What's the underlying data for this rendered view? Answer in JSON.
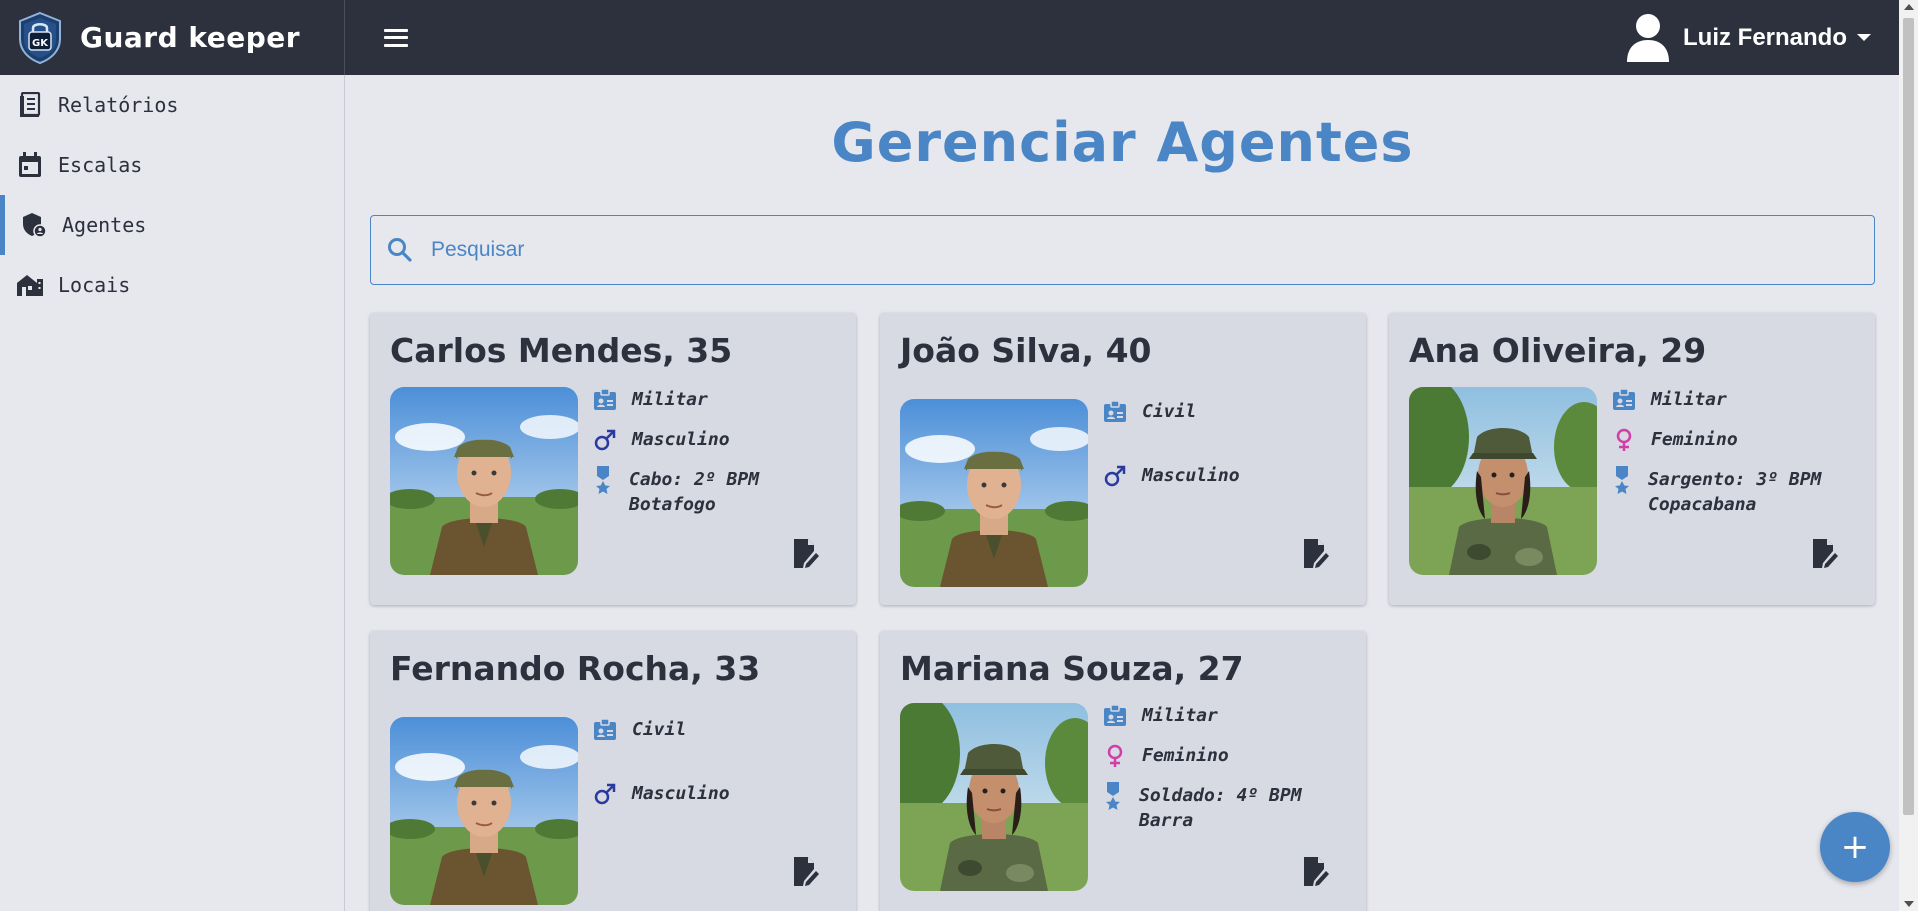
{
  "app": {
    "name": "Guard keeper",
    "logo_text": "GK"
  },
  "user": {
    "name": "Luiz Fernando"
  },
  "sidebar": {
    "items": [
      {
        "label": "Relatórios",
        "icon": "report-icon"
      },
      {
        "label": "Escalas",
        "icon": "calendar-icon"
      },
      {
        "label": "Agentes",
        "icon": "shield-user-icon",
        "active": true
      },
      {
        "label": "Locais",
        "icon": "buildings-icon"
      }
    ]
  },
  "main": {
    "title": "Gerenciar Agentes",
    "search": {
      "placeholder": "Pesquisar",
      "value": ""
    }
  },
  "agents": [
    {
      "title": "Carlos Mendes, 35",
      "type": "Militar",
      "gender": "Masculino",
      "rank_line1": "Cabo: 2º BPM",
      "rank_line2": "Botafogo",
      "photo": "male-soldier"
    },
    {
      "title": "João Silva, 40",
      "type": "Civil",
      "gender": "Masculino",
      "photo": "male-soldier"
    },
    {
      "title": "Ana Oliveira, 29",
      "type": "Militar",
      "gender": "Feminino",
      "rank_line1": "Sargento: 3º BPM",
      "rank_line2": "Copacabana",
      "photo": "female-soldier"
    },
    {
      "title": "Fernando Rocha, 33",
      "type": "Civil",
      "gender": "Masculino",
      "photo": "male-soldier"
    },
    {
      "title": "Mariana Souza, 27",
      "type": "Militar",
      "gender": "Feminino",
      "rank_line1": "Soldado: 4º BPM",
      "rank_line2": "Barra",
      "photo": "female-soldier"
    }
  ],
  "fab": {
    "label": "+"
  },
  "colors": {
    "accent": "#4a86c5",
    "topbar": "#2d303d",
    "card": "#d7d9e3",
    "male": "#2b3a9e",
    "female": "#d23ea8"
  }
}
